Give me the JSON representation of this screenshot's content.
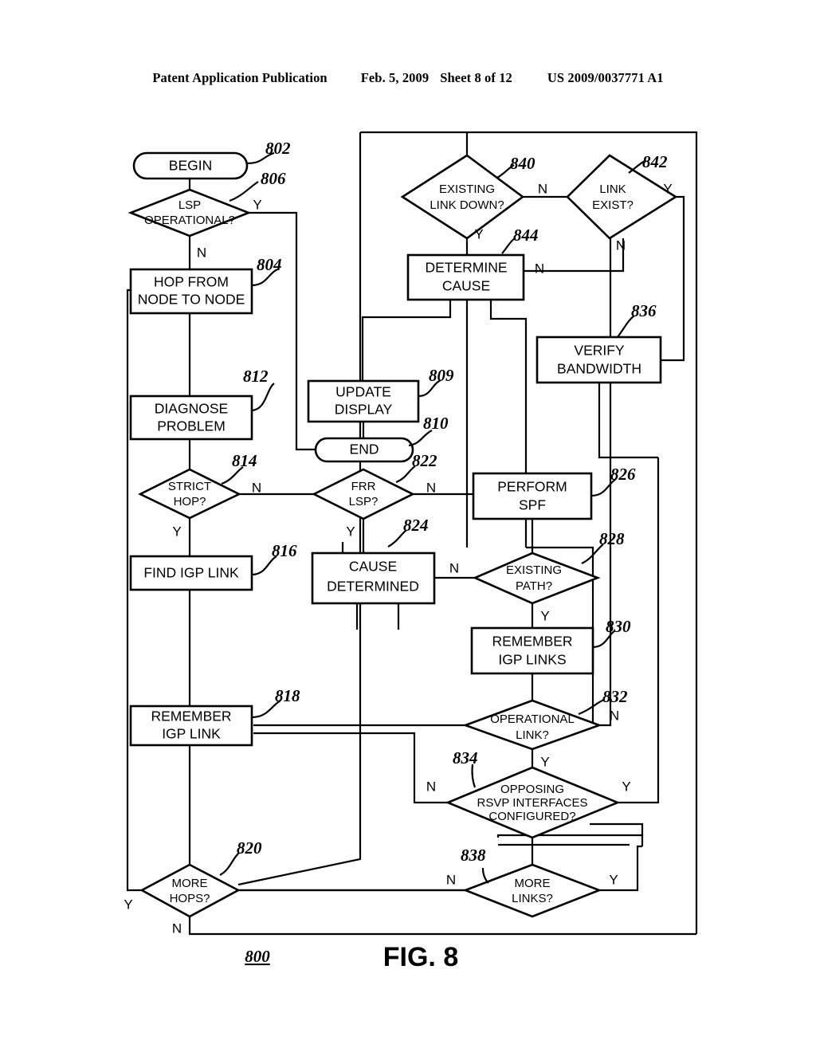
{
  "header": {
    "publication": "Patent Application Publication",
    "date": "Feb. 5, 2009",
    "sheet": "Sheet 8 of 12",
    "number": "US 2009/0037771 A1"
  },
  "figure": {
    "label": "FIG. 8",
    "reference": "800"
  },
  "nodes": {
    "begin": {
      "ref": "802",
      "label": "BEGIN"
    },
    "lsp_operational": {
      "ref": "806",
      "line1": "LSP",
      "line2": "OPERATIONAL?"
    },
    "hop_from_node": {
      "ref": "804",
      "line1": "HOP FROM",
      "line2": "NODE TO NODE"
    },
    "diagnose": {
      "ref": "812",
      "line1": "DIAGNOSE",
      "line2": "PROBLEM"
    },
    "strict_hop": {
      "ref": "814",
      "line1": "STRICT",
      "line2": "HOP?"
    },
    "find_igp_link": {
      "ref": "816",
      "line1": "FIND IGP LINK",
      "line2": ""
    },
    "remember_igp_link": {
      "ref": "818",
      "line1": "REMEMBER",
      "line2": "IGP LINK"
    },
    "more_hops": {
      "ref": "820",
      "line1": "MORE",
      "line2": "HOPS?"
    },
    "update_display": {
      "ref": "809",
      "line1": "UPDATE",
      "line2": "DISPLAY"
    },
    "end": {
      "ref": "810",
      "label": "END"
    },
    "frr_lsp": {
      "ref": "822",
      "line1": "FRR",
      "line2": "LSP?"
    },
    "cause_determined": {
      "ref": "824",
      "line1": "CAUSE",
      "line2": "DETERMINED"
    },
    "perform_spf": {
      "ref": "826",
      "line1": "PERFORM",
      "line2": "SPF"
    },
    "existing_path": {
      "ref": "828",
      "line1": "EXISTING",
      "line2": "PATH?"
    },
    "remember_igp_links": {
      "ref": "830",
      "line1": "REMEMBER",
      "line2": "IGP LINKS"
    },
    "operational_link": {
      "ref": "832",
      "line1": "OPERATIONAL",
      "line2": "LINK?"
    },
    "opposing_rsvp": {
      "ref": "834",
      "line1": "OPPOSING",
      "line2": "RSVP INTERFACES",
      "line3": "CONFIGURED?"
    },
    "verify_bandwidth": {
      "ref": "836",
      "line1": "VERIFY",
      "line2": "BANDWIDTH"
    },
    "more_links": {
      "ref": "838",
      "line1": "MORE",
      "line2": "LINKS?"
    },
    "existing_link_down": {
      "ref": "840",
      "line1": "EXISTING",
      "line2": "LINK DOWN?"
    },
    "link_exist": {
      "ref": "842",
      "line1": "LINK",
      "line2": "EXIST?"
    },
    "determine_cause": {
      "ref": "844",
      "line1": "DETERMINE",
      "line2": "CAUSE"
    }
  },
  "branches": {
    "lsp_y": "Y",
    "lsp_n": "N",
    "strict_y": "Y",
    "strict_n": "N",
    "more_hops_y": "Y",
    "more_hops_n": "N",
    "frr_y": "Y",
    "frr_n": "N",
    "existing_path_n": "N",
    "existing_path_y": "Y",
    "operational_link_n": "N",
    "operational_link_y": "Y",
    "opposing_n": "N",
    "opposing_y": "Y",
    "more_links_n": "N",
    "more_links_y": "Y",
    "existing_link_down_y": "Y",
    "existing_link_down_n": "N",
    "link_exist_y": "Y",
    "link_exist_n": "N",
    "determine_cause_n": "N"
  },
  "colors": {
    "ink": "#000000",
    "paper": "#ffffff"
  }
}
